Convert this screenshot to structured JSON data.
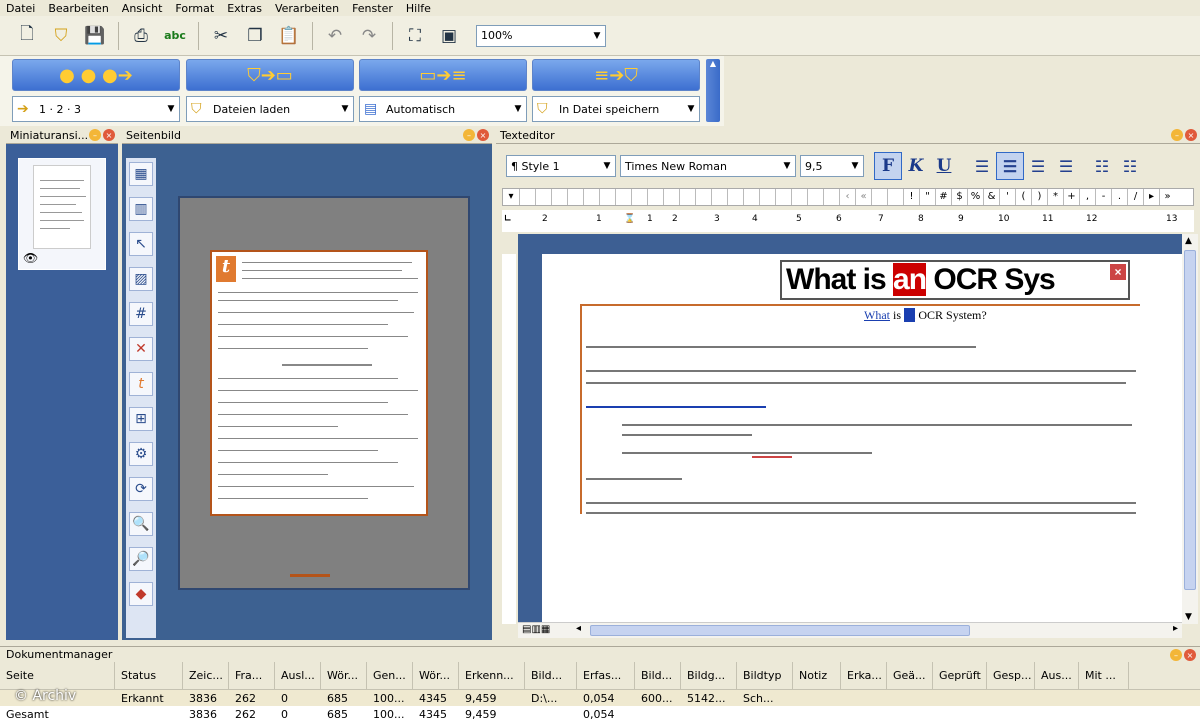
{
  "menu": [
    "Datei",
    "Bearbeiten",
    "Ansicht",
    "Format",
    "Extras",
    "Verarbeiten",
    "Fenster",
    "Hilfe"
  ],
  "toolbar": {
    "icons": [
      "new-document-icon",
      "open-icon",
      "save-icon",
      "print-icon",
      "spellcheck-icon",
      "cut-icon",
      "copy-icon",
      "paste-icon",
      "undo-icon",
      "redo-icon",
      "zoom-fit-icon",
      "image-icon"
    ],
    "zoom": "100%"
  },
  "workflow": [
    {
      "step_icon": "steps-icon",
      "select": "1 · 2 · 3"
    },
    {
      "step_icon": "load-files-icon",
      "select": "Dateien laden"
    },
    {
      "step_icon": "recognize-icon",
      "select": "Automatisch"
    },
    {
      "step_icon": "save-file-icon",
      "select": "In Datei speichern"
    }
  ],
  "panes": {
    "thumbnails": "Miniaturansi...",
    "page_view": "Seitenbild",
    "editor": "Texteditor",
    "doc_manager": "Dokumentmanager"
  },
  "editor": {
    "style": "Style 1",
    "font": "Times New Roman",
    "size": "9,5",
    "bold": "F",
    "italic": "K",
    "underline": "U",
    "chars": [
      "!",
      "\"",
      "#",
      "$",
      "%",
      "&",
      "'",
      "(",
      ")",
      "*",
      "+",
      ",",
      "-",
      ".",
      "/"
    ],
    "ruler": [
      "2",
      "1",
      "1",
      "2",
      "3",
      "4",
      "5",
      "6",
      "7",
      "8",
      "9",
      "10",
      "11",
      "12",
      "13"
    ],
    "ocr_banner_pre": "What is ",
    "ocr_banner_hl": "an",
    "ocr_banner_post": " OCR Sys",
    "ocr_small_pre": "What",
    "ocr_small_mid": " is ",
    "ocr_small_post": " OCR System?"
  },
  "doc_manager": {
    "columns": [
      "Seite",
      "Status",
      "Zeic...",
      "Fra...",
      "Ausl...",
      "Wör...",
      "Gen...",
      "Wör...",
      "Erkenn...",
      "Bild...",
      "Erfas...",
      "Bild...",
      "Bildg...",
      "Bildtyp",
      "Notiz",
      "Erka...",
      "Geä...",
      "Geprüft",
      "Gesp...",
      "Aus...",
      "Mit ..."
    ],
    "rows": [
      [
        "",
        "Erkannt",
        "3836",
        "262",
        "0",
        "685",
        "100...",
        "4345",
        "9,459",
        "D:\\...",
        "0,054",
        "600...",
        "5142...",
        "Sch...",
        "",
        "",
        "",
        "",
        "",
        "",
        ""
      ],
      [
        "Gesamt",
        "",
        "3836",
        "262",
        "0",
        "685",
        "100...",
        "4345",
        "9,459",
        "",
        "0,054",
        "",
        "",
        "",
        "",
        "",
        "",
        "",
        "",
        "",
        ""
      ]
    ]
  },
  "watermark": "© Archiv"
}
